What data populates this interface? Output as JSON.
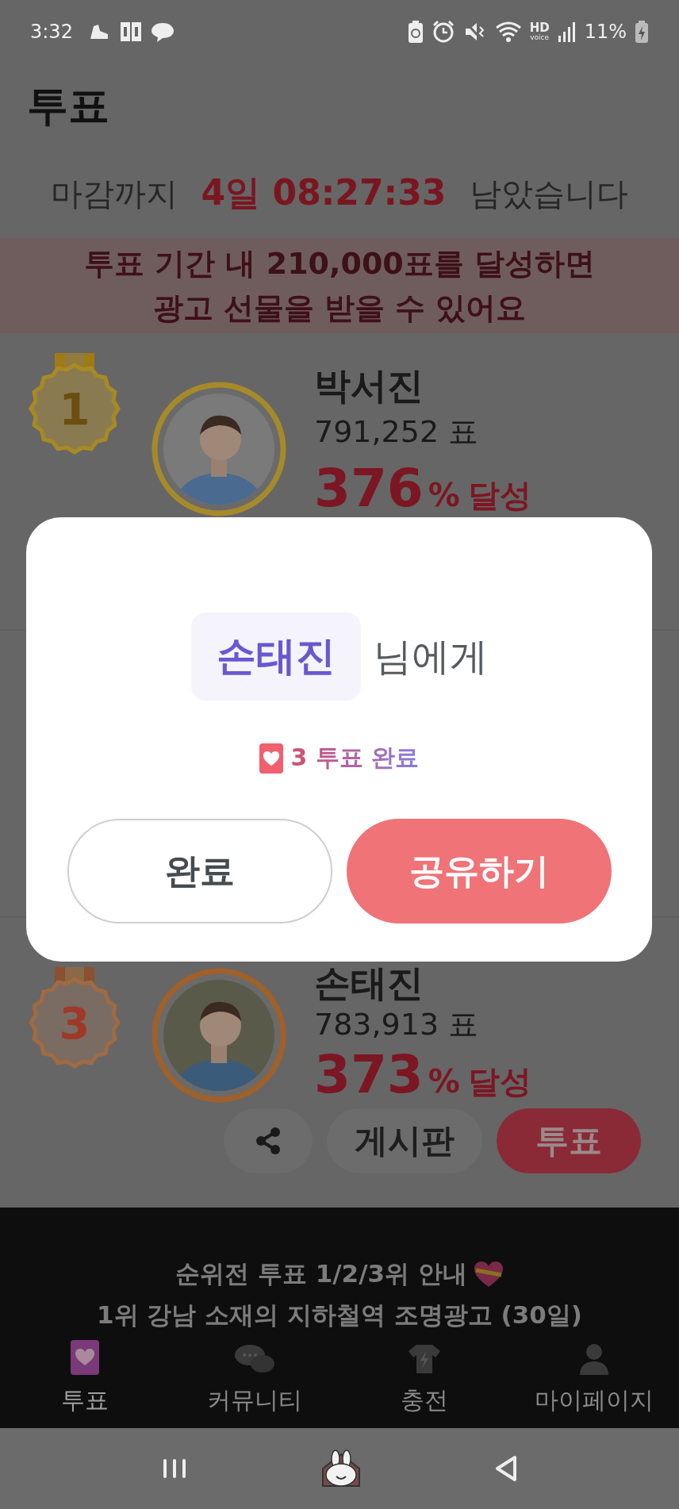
{
  "status_bar": {
    "time": "3:32",
    "hd": "HD",
    "voice": "voice",
    "battery": "11%"
  },
  "title": "투표",
  "countdown": {
    "prefix": "마감까지",
    "remaining": "4일 08:27:33",
    "suffix": "남았습니다"
  },
  "goal_banner": [
    "투표 기간 내 210,000표를 달성하면",
    "광고 선물을 받을 수 있어요"
  ],
  "ranks": [
    {
      "rank": "1",
      "kind": "gold",
      "name": "박서진",
      "votes": "791,252 표",
      "percent": "376",
      "percent_sign": "%",
      "achieved": "달성"
    },
    {
      "rank": "3",
      "kind": "bronze",
      "name": "손태진",
      "votes": "783,913 표",
      "percent": "373",
      "percent_sign": "%",
      "achieved": "달성",
      "actions": {
        "board": "게시판",
        "vote": "투표"
      }
    }
  ],
  "modal": {
    "recipient": "손태진",
    "suffix": "님에게",
    "result": "3 투표 완료",
    "buttons": [
      {
        "label": "완료",
        "kind": "secondary"
      },
      {
        "label": "공유하기",
        "kind": "primary"
      }
    ]
  },
  "notice": [
    "순위전 투표 1/2/3위 안내",
    "1위 강남 소재의 지하철역 조명광고 (30일)"
  ],
  "bottom_nav": [
    {
      "label": "투표",
      "selected": true
    },
    {
      "label": "커뮤니티",
      "selected": false
    },
    {
      "label": "충전",
      "selected": false
    },
    {
      "label": "마이페이지",
      "selected": false
    }
  ]
}
